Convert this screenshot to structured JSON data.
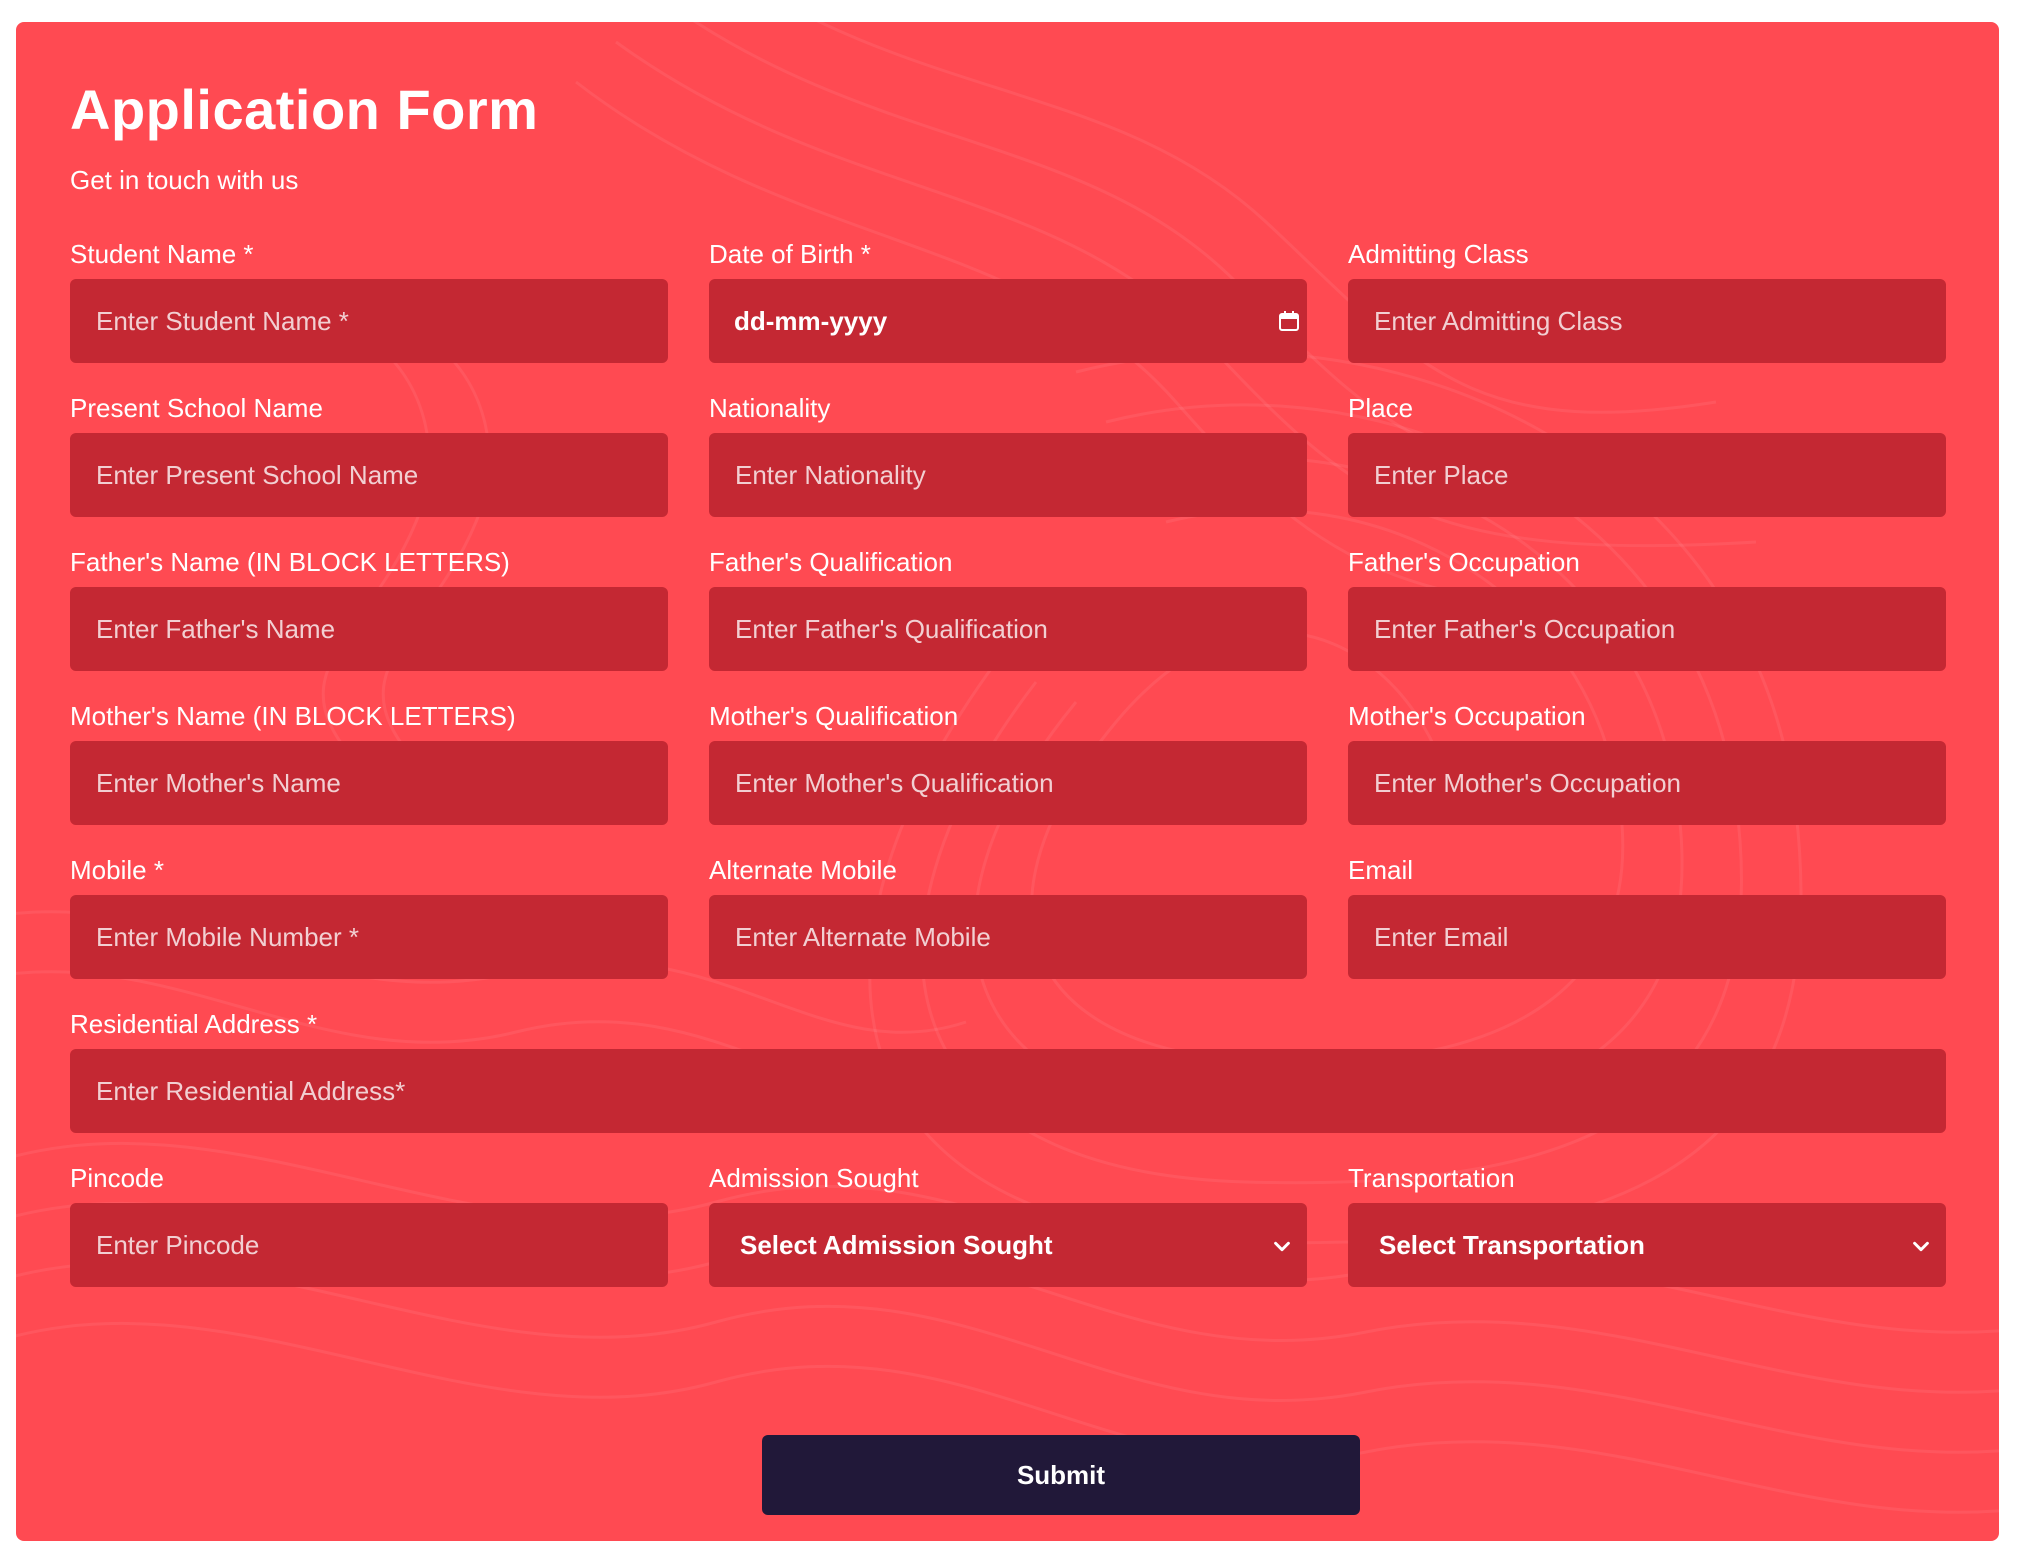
{
  "form": {
    "title": "Application Form",
    "subtitle": "Get in touch with us",
    "colors": {
      "background": "#ff4a52",
      "field": "#c42833",
      "button": "#211839",
      "text": "#ffffff"
    }
  },
  "fields": {
    "student_name": {
      "label": "Student Name *",
      "placeholder": "Enter Student Name *"
    },
    "dob": {
      "label": "Date of Birth *",
      "value": "dd-mm-yyyy",
      "icon": "calendar-icon"
    },
    "admitting_class": {
      "label": "Admitting Class",
      "placeholder": "Enter Admitting Class"
    },
    "present_school": {
      "label": "Present School Name",
      "placeholder": "Enter Present School Name"
    },
    "nationality": {
      "label": "Nationality",
      "placeholder": "Enter Nationality"
    },
    "place": {
      "label": "Place",
      "placeholder": "Enter Place"
    },
    "father_name": {
      "label": "Father's Name (IN BLOCK LETTERS)",
      "placeholder": "Enter Father's Name"
    },
    "father_qualification": {
      "label": "Father's Qualification",
      "placeholder": "Enter Father's Qualification"
    },
    "father_occupation": {
      "label": "Father's Occupation",
      "placeholder": "Enter Father's Occupation"
    },
    "mother_name": {
      "label": "Mother's Name (IN BLOCK LETTERS)",
      "placeholder": "Enter Mother's Name"
    },
    "mother_qualification": {
      "label": "Mother's Qualification",
      "placeholder": "Enter Mother's Qualification"
    },
    "mother_occupation": {
      "label": "Mother's Occupation",
      "placeholder": "Enter Mother's Occupation"
    },
    "mobile": {
      "label": "Mobile *",
      "placeholder": "Enter Mobile Number *"
    },
    "alternate_mobile": {
      "label": "Alternate Mobile",
      "placeholder": "Enter Alternate Mobile"
    },
    "email": {
      "label": "Email",
      "placeholder": "Enter Email"
    },
    "address": {
      "label": "Residential Address *",
      "placeholder": "Enter Residential Address*"
    },
    "pincode": {
      "label": "Pincode",
      "placeholder": "Enter Pincode"
    },
    "admission_sought": {
      "label": "Admission Sought",
      "selected": "Select Admission Sought",
      "icon": "chevron-down-icon"
    },
    "transportation": {
      "label": "Transportation",
      "selected": "Select Transportation",
      "icon": "chevron-down-icon"
    }
  },
  "submit": {
    "label": "Submit"
  }
}
